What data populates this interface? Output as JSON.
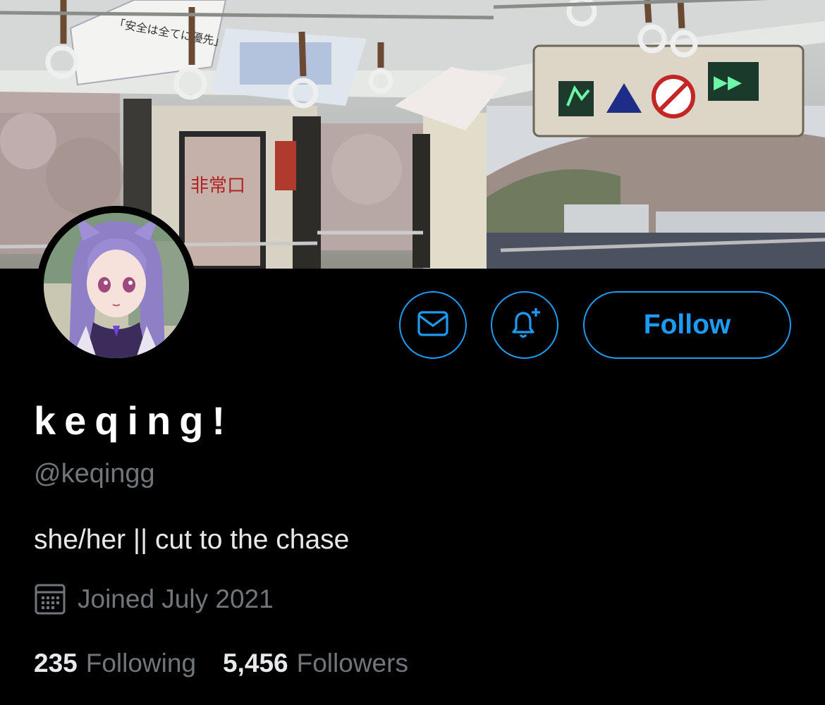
{
  "profile": {
    "display_name": "keqing!",
    "handle": "@keqingg",
    "bio": "she/her || cut to the chase",
    "joined": "Joined July 2021",
    "following_count": "235",
    "following_label": "Following",
    "followers_count": "5,456",
    "followers_label": "Followers"
  },
  "actions": {
    "follow_label": "Follow",
    "message_icon": "mail-icon",
    "notify_icon": "bell-plus-icon"
  },
  "banner": {
    "sign_exit": "非常口",
    "sign_safety": "「安全は全てに優先」"
  },
  "colors": {
    "accent": "#1d9bf0",
    "muted": "#71767b",
    "background": "#000000"
  }
}
